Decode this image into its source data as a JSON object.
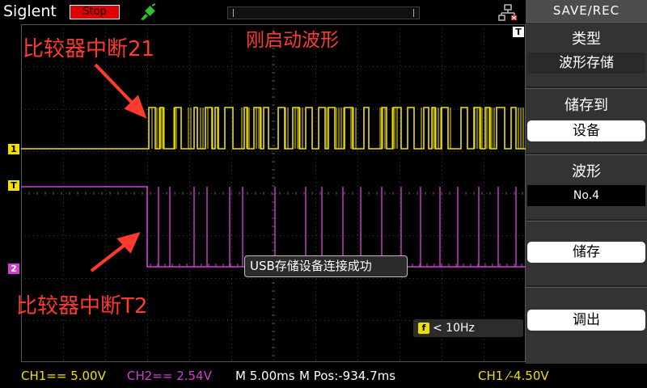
{
  "header": {
    "brand": "Siglent",
    "run_state": "Stop",
    "run_state_color": "#e00000"
  },
  "annotations": {
    "top_center": "刚启动波形",
    "ch1_note": "比较器中断21",
    "ch2_note": "比较器中断T2",
    "color": "#ff3b2f"
  },
  "channels": [
    {
      "id": "1",
      "color": "#f0e000"
    },
    {
      "id": "2",
      "color": "#d040d0"
    }
  ],
  "trigger_marker": "T",
  "toast": "USB存储设备连接成功",
  "freq": {
    "icon": "f",
    "text": "< 10Hz"
  },
  "status": {
    "ch1": "CH1== 5.00V",
    "ch2": "CH2== 2.54V",
    "timebase": "M 5.00ms",
    "mpos": "M Pos:-934.7ms",
    "trigger": "CH1 ⁄-4.50V"
  },
  "menu": {
    "title": "SAVE/REC",
    "items": [
      {
        "label": "类型",
        "value": "波形存储"
      },
      {
        "label": "储存到",
        "value": "设备"
      },
      {
        "label": "波形",
        "value": "No.4"
      },
      {
        "label": "",
        "value": "储存"
      },
      {
        "label": "",
        "value": "调出"
      }
    ]
  },
  "icons": {
    "probe": "probe-icon",
    "usb": "usb-icon"
  }
}
